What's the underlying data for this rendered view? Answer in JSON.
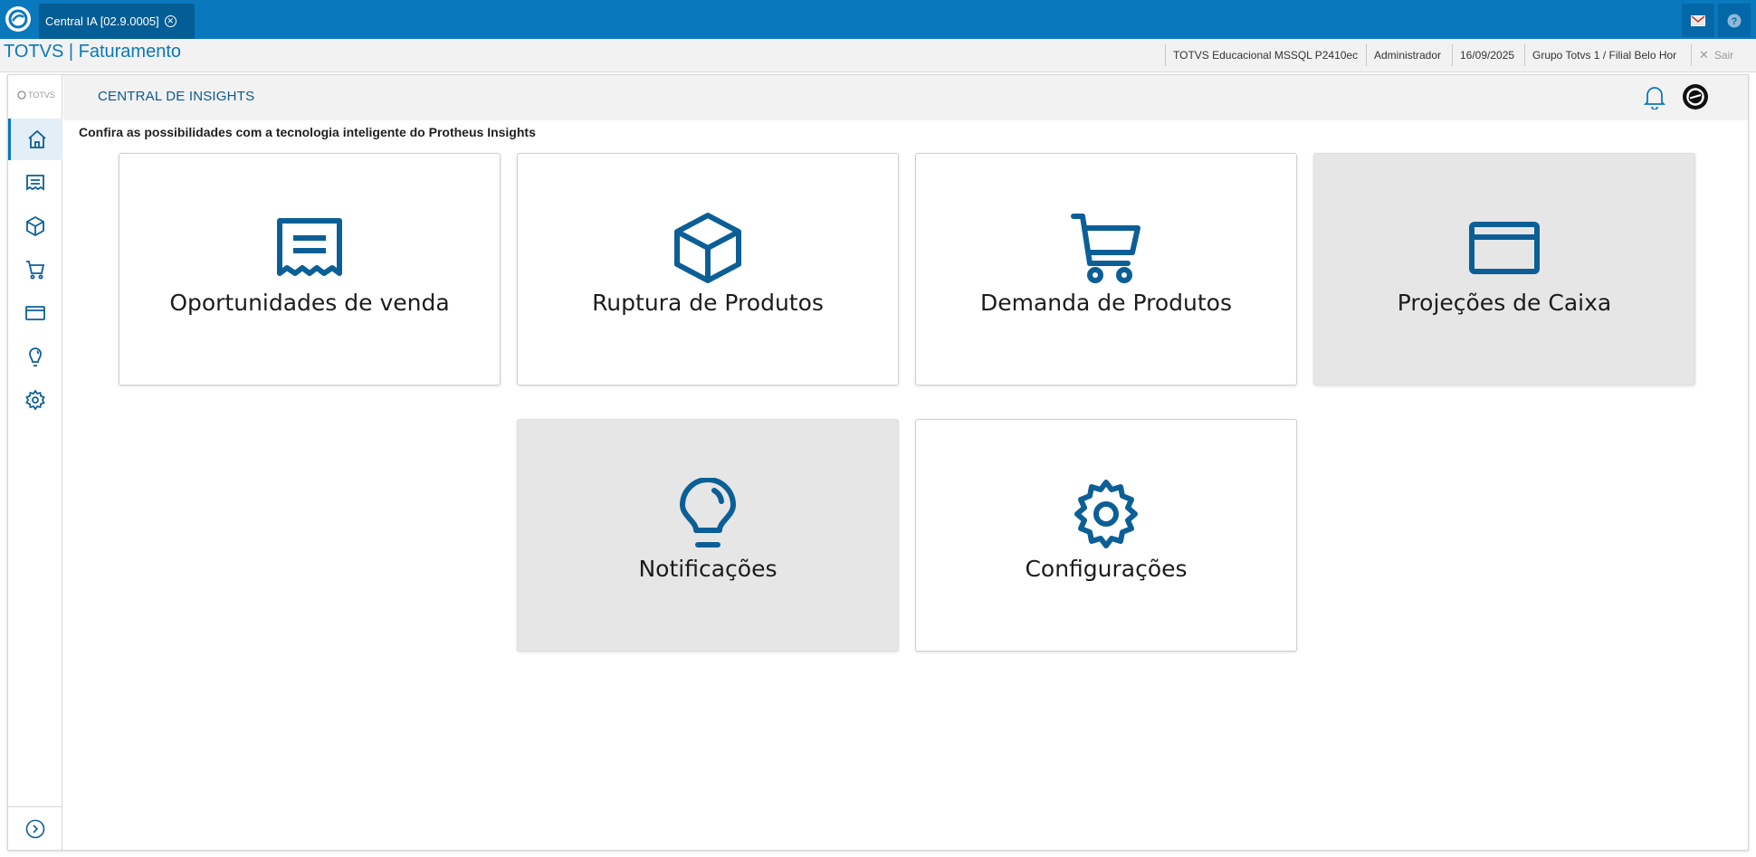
{
  "window": {
    "tab_label": "Central IA [02.9.0005]",
    "close_glyph": "✕"
  },
  "header": {
    "app_title": "TOTVS | Faturamento",
    "environment": "TOTVS Educacional MSSQL P2410ec",
    "user": "Administrador",
    "date": "16/09/2025",
    "branch": "Grupo Totvs 1 / Filial Belo Hor",
    "exit_label": "Sair"
  },
  "sidebar": {
    "brand": "TOTVS",
    "items": [
      {
        "icon": "home-icon",
        "active": true
      },
      {
        "icon": "receipt-icon",
        "active": false
      },
      {
        "icon": "box-icon",
        "active": false
      },
      {
        "icon": "cart-icon",
        "active": false
      },
      {
        "icon": "card-icon",
        "active": false
      },
      {
        "icon": "lightbulb-icon",
        "active": false
      },
      {
        "icon": "gear-icon",
        "active": false
      }
    ],
    "expand_icon": "chevron-right-circle-icon"
  },
  "page": {
    "title": "CENTRAL DE INSIGHTS",
    "subtitle": "Confira as possibilidades com a tecnologia inteligente do Protheus Insights"
  },
  "cards": [
    {
      "label": "Oportunidades de venda",
      "icon": "receipt-icon",
      "enabled": true
    },
    {
      "label": "Ruptura de Produtos",
      "icon": "box-icon",
      "enabled": true
    },
    {
      "label": "Demanda de Produtos",
      "icon": "cart-icon",
      "enabled": true
    },
    {
      "label": "Projeções de Caixa",
      "icon": "card-icon",
      "enabled": false
    },
    {
      "label": "Notificações",
      "icon": "lightbulb-icon",
      "enabled": false
    },
    {
      "label": "Configurações",
      "icon": "gear-icon",
      "enabled": true
    }
  ],
  "colors": {
    "brand_blue": "#0a78bd",
    "icon_blue": "#0c5f96",
    "disabled_card": "#e6e6e6"
  }
}
